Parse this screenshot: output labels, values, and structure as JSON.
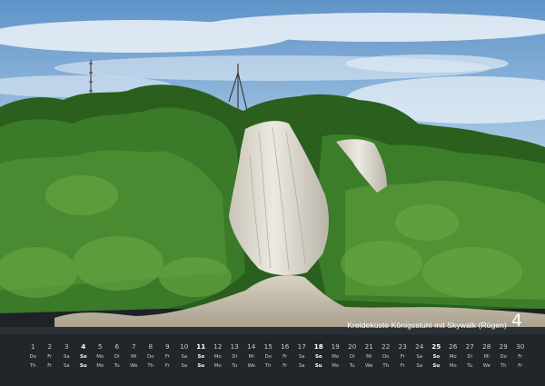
{
  "photo": {
    "subject": "chalk-cliff-photo",
    "colors": {
      "sky": "#6a9fd0",
      "forest": "#2f6a22",
      "chalk": "#dcd8cf",
      "water": "#2a3036"
    }
  },
  "caption": "Kreideküste Königsstuhl mit Skywalk (Rügen)",
  "month_number": "4",
  "days": [
    {
      "n": "1",
      "w1": "Do",
      "w2": "Th",
      "sunday": false
    },
    {
      "n": "2",
      "w1": "Fr",
      "w2": "Fr",
      "sunday": false
    },
    {
      "n": "3",
      "w1": "Sa",
      "w2": "Sa",
      "sunday": false
    },
    {
      "n": "4",
      "w1": "So",
      "w2": "Su",
      "sunday": true
    },
    {
      "n": "5",
      "w1": "Mo",
      "w2": "Mo",
      "sunday": false
    },
    {
      "n": "6",
      "w1": "Di",
      "w2": "Tu",
      "sunday": false
    },
    {
      "n": "7",
      "w1": "Mi",
      "w2": "We",
      "sunday": false
    },
    {
      "n": "8",
      "w1": "Do",
      "w2": "Th",
      "sunday": false
    },
    {
      "n": "9",
      "w1": "Fr",
      "w2": "Fr",
      "sunday": false
    },
    {
      "n": "10",
      "w1": "Sa",
      "w2": "Sa",
      "sunday": false
    },
    {
      "n": "11",
      "w1": "So",
      "w2": "Su",
      "sunday": true
    },
    {
      "n": "12",
      "w1": "Mo",
      "w2": "Mo",
      "sunday": false
    },
    {
      "n": "13",
      "w1": "Di",
      "w2": "Tu",
      "sunday": false
    },
    {
      "n": "14",
      "w1": "Mi",
      "w2": "We",
      "sunday": false
    },
    {
      "n": "15",
      "w1": "Do",
      "w2": "Th",
      "sunday": false
    },
    {
      "n": "16",
      "w1": "Fr",
      "w2": "Fr",
      "sunday": false
    },
    {
      "n": "17",
      "w1": "Sa",
      "w2": "Sa",
      "sunday": false
    },
    {
      "n": "18",
      "w1": "So",
      "w2": "Su",
      "sunday": true
    },
    {
      "n": "19",
      "w1": "Mo",
      "w2": "Mo",
      "sunday": false
    },
    {
      "n": "20",
      "w1": "Di",
      "w2": "Tu",
      "sunday": false
    },
    {
      "n": "21",
      "w1": "Mi",
      "w2": "We",
      "sunday": false
    },
    {
      "n": "22",
      "w1": "Do",
      "w2": "Th",
      "sunday": false
    },
    {
      "n": "23",
      "w1": "Fr",
      "w2": "Fr",
      "sunday": false
    },
    {
      "n": "24",
      "w1": "Sa",
      "w2": "Sa",
      "sunday": false
    },
    {
      "n": "25",
      "w1": "So",
      "w2": "Su",
      "sunday": true
    },
    {
      "n": "26",
      "w1": "Mo",
      "w2": "Mo",
      "sunday": false
    },
    {
      "n": "27",
      "w1": "Di",
      "w2": "Tu",
      "sunday": false
    },
    {
      "n": "28",
      "w1": "Mi",
      "w2": "We",
      "sunday": false
    },
    {
      "n": "29",
      "w1": "Do",
      "w2": "Th",
      "sunday": false
    },
    {
      "n": "30",
      "w1": "Fr",
      "w2": "Fr",
      "sunday": false
    }
  ]
}
